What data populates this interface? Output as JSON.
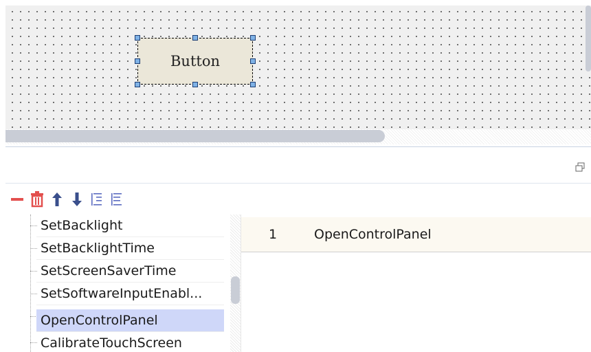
{
  "canvas": {
    "button_label": "Button"
  },
  "panel": {
    "restore_icon": "restore-window-icon"
  },
  "toolbar": {
    "icons": [
      "minus-icon",
      "trash-icon",
      "move-up-icon",
      "move-down-icon",
      "indent-icon",
      "outdent-icon"
    ],
    "colors": {
      "red": "#e3504e",
      "blue": "#3a4f8c",
      "outline": "#5b6bc0"
    }
  },
  "list": {
    "items": [
      "SetBacklight",
      "SetBacklightTime",
      "SetScreenSaverTime",
      "SetSoftwareInputEnabl...",
      "OpenControlPanel",
      "CalibrateTouchScreen"
    ],
    "selected": "OpenControlPanel"
  },
  "grid": {
    "rows": [
      {
        "index": "1",
        "name": "OpenControlPanel"
      }
    ]
  }
}
